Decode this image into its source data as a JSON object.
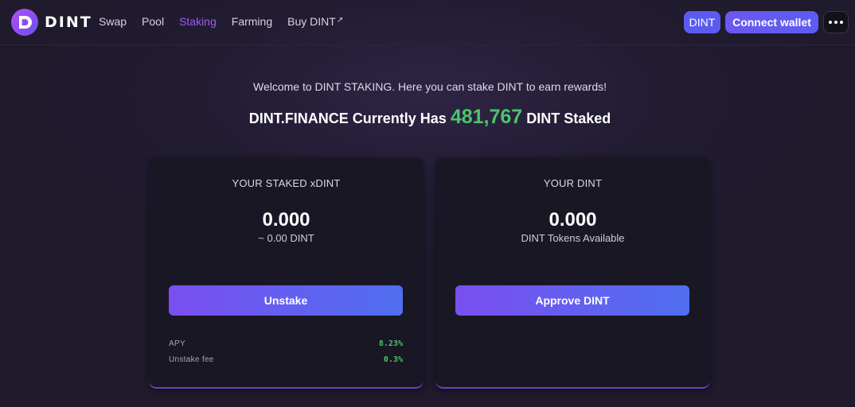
{
  "brand": {
    "name": "DINT"
  },
  "nav": [
    {
      "label": "Swap",
      "active": false,
      "external": false
    },
    {
      "label": "Pool",
      "active": false,
      "external": false
    },
    {
      "label": "Staking",
      "active": true,
      "external": false
    },
    {
      "label": "Farming",
      "active": false,
      "external": false
    },
    {
      "label": "Buy DINT",
      "active": false,
      "external": true
    }
  ],
  "header": {
    "token_label": "DINT",
    "connect_label": "Connect wallet",
    "more_icon": "ellipsis-icon"
  },
  "hero": {
    "welcome": "Welcome to DINT STAKING. Here you can stake DINT to earn rewards!",
    "headline_prefix": "DINT.FINANCE Currently Has",
    "staked_amount": "481,767",
    "headline_suffix": "DINT Staked"
  },
  "staked_card": {
    "title": "YOUR STAKED xDINT",
    "value": "0.000",
    "sub": "~ 0.00 DINT",
    "button": "Unstake",
    "stats": [
      {
        "label": "APY",
        "value": "8.23%"
      },
      {
        "label": "Unstake fee",
        "value": "0.3%"
      }
    ]
  },
  "dint_card": {
    "title": "YOUR DINT",
    "value": "0.000",
    "sub": "DINT Tokens Available",
    "button": "Approve DINT"
  },
  "colors": {
    "accent": "#9d5cf0",
    "green": "#4cc46a",
    "button_start": "#7a4ff0",
    "button_end": "#4f6ef0",
    "background": "#221c33"
  }
}
